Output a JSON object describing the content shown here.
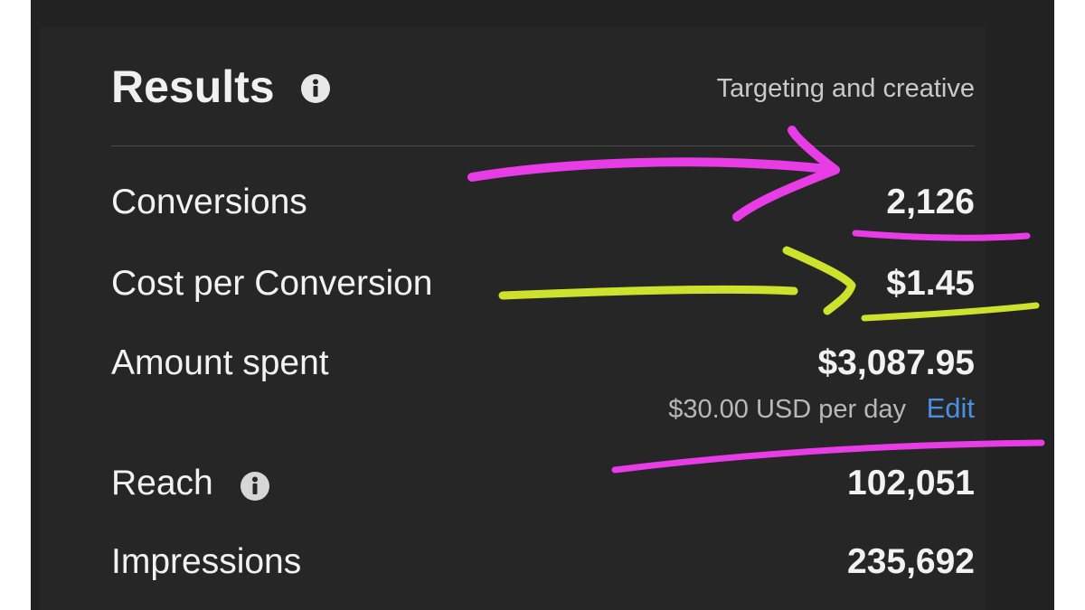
{
  "header": {
    "title": "Results",
    "tab_label": "Targeting and creative"
  },
  "metrics": {
    "conversions": {
      "label": "Conversions",
      "value": "2,126"
    },
    "cost_per_conversion": {
      "label": "Cost per Conversion",
      "value": "$1.45"
    },
    "amount_spent": {
      "label": "Amount spent",
      "value": "$3,087.95",
      "budget": "$30.00 USD per day",
      "edit_label": "Edit"
    },
    "reach": {
      "label": "Reach",
      "value": "102,051"
    },
    "impressions": {
      "label": "Impressions",
      "value": "235,692"
    }
  },
  "icons": {
    "title_info": "info-icon",
    "reach_info": "info-icon"
  },
  "colors": {
    "background": "#222222",
    "card": "#262626",
    "text": "#f2f2f2",
    "link": "#4a8fe0",
    "annotation_magenta": "#e83ce6",
    "annotation_yellow": "#cde22c"
  }
}
